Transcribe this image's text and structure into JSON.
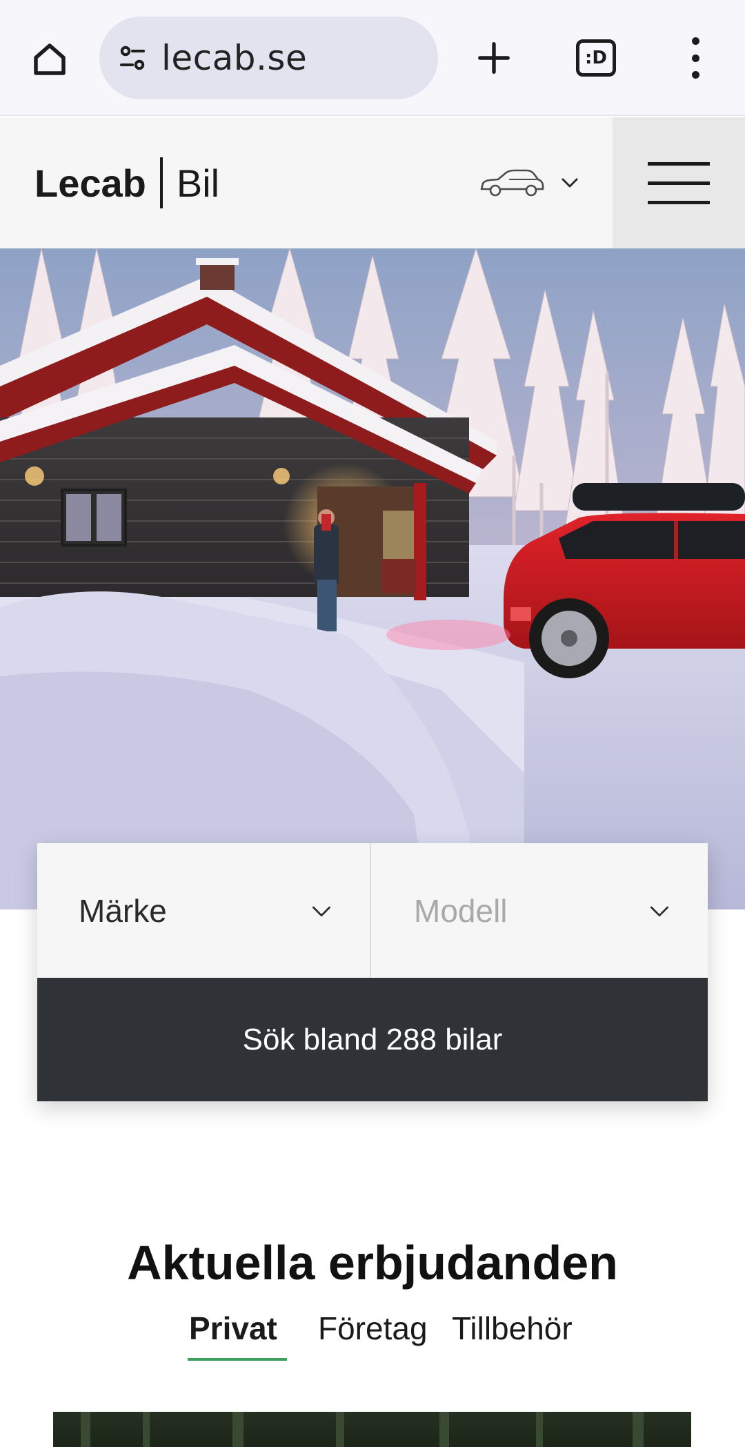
{
  "browser": {
    "url": "lecab.se",
    "tab_switcher_label": ":D"
  },
  "header": {
    "brand": "Lecab",
    "section": "Bil"
  },
  "search": {
    "brand_placeholder": "Märke",
    "model_placeholder": "Modell",
    "button_label": "Sök bland 288 bilar"
  },
  "offers": {
    "title": "Aktuella erbjudanden",
    "tabs": [
      {
        "label": "Privat",
        "active": true
      },
      {
        "label": "Företag",
        "active": false
      },
      {
        "label": "Tillbehör",
        "active": false
      }
    ]
  },
  "colors": {
    "button_bg": "#2f3237",
    "active_tab_underline": "#3ea05f",
    "car_red": "#d21a1f"
  }
}
